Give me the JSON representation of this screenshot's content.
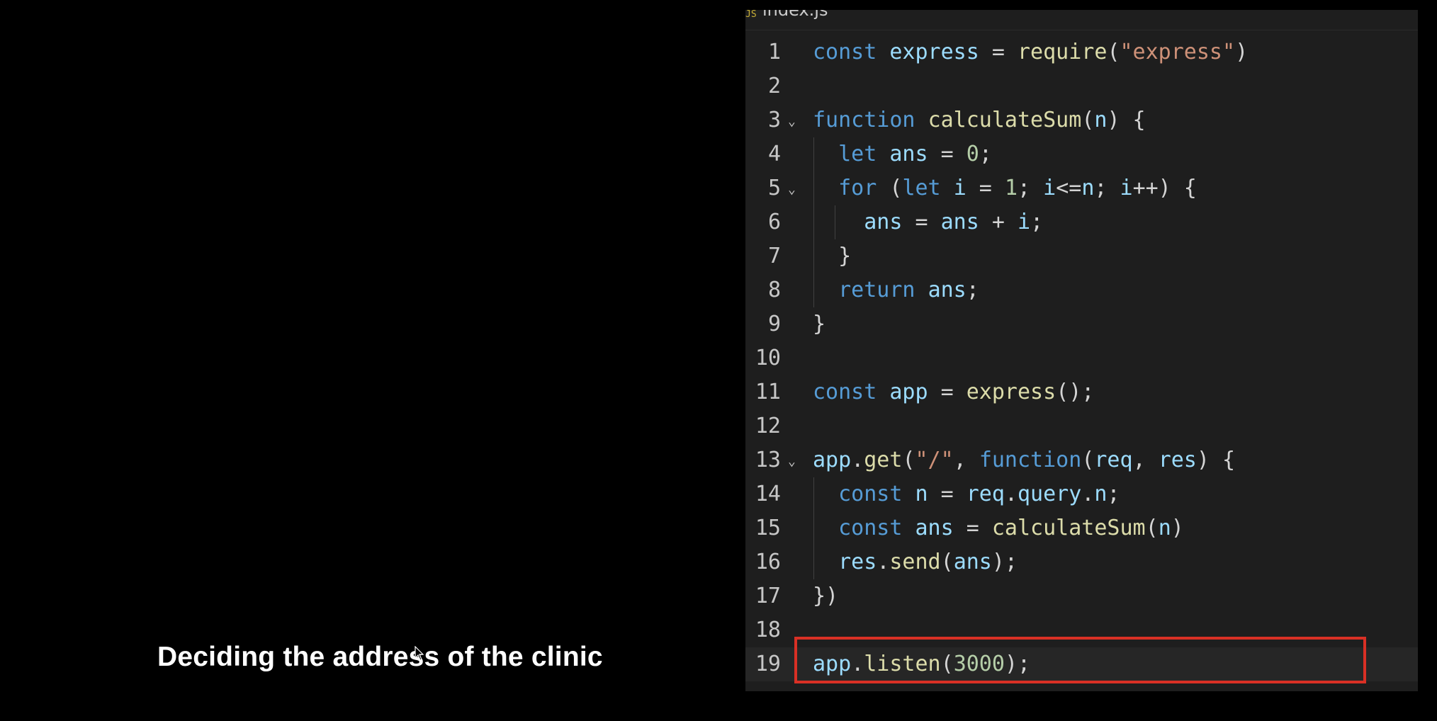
{
  "caption": "Deciding the address of the clinic",
  "editor": {
    "tab_label": "index.js",
    "tab_icon": "JS",
    "current_line": 19,
    "lines": [
      {
        "num": "1",
        "fold": "",
        "tokens": [
          {
            "t": "const",
            "c": "k"
          },
          {
            "t": " ",
            "c": "p"
          },
          {
            "t": "express",
            "c": "v"
          },
          {
            "t": " = ",
            "c": "p"
          },
          {
            "t": "require",
            "c": "f"
          },
          {
            "t": "(",
            "c": "p"
          },
          {
            "t": "\"express\"",
            "c": "s"
          },
          {
            "t": ")",
            "c": "p"
          }
        ]
      },
      {
        "num": "2",
        "fold": "",
        "tokens": []
      },
      {
        "num": "3",
        "fold": "⌄",
        "tokens": [
          {
            "t": "function",
            "c": "k"
          },
          {
            "t": " ",
            "c": "p"
          },
          {
            "t": "calculateSum",
            "c": "f"
          },
          {
            "t": "(",
            "c": "p"
          },
          {
            "t": "n",
            "c": "v"
          },
          {
            "t": ") {",
            "c": "p"
          }
        ]
      },
      {
        "num": "4",
        "fold": "",
        "tokens": [
          {
            "t": "  ",
            "c": "p"
          },
          {
            "t": "let",
            "c": "k"
          },
          {
            "t": " ",
            "c": "p"
          },
          {
            "t": "ans",
            "c": "v"
          },
          {
            "t": " = ",
            "c": "p"
          },
          {
            "t": "0",
            "c": "n"
          },
          {
            "t": ";",
            "c": "p"
          }
        ]
      },
      {
        "num": "5",
        "fold": "⌄",
        "tokens": [
          {
            "t": "  ",
            "c": "p"
          },
          {
            "t": "for",
            "c": "k"
          },
          {
            "t": " (",
            "c": "p"
          },
          {
            "t": "let",
            "c": "k"
          },
          {
            "t": " ",
            "c": "p"
          },
          {
            "t": "i",
            "c": "v"
          },
          {
            "t": " = ",
            "c": "p"
          },
          {
            "t": "1",
            "c": "n"
          },
          {
            "t": "; ",
            "c": "p"
          },
          {
            "t": "i",
            "c": "v"
          },
          {
            "t": "<=",
            "c": "p"
          },
          {
            "t": "n",
            "c": "v"
          },
          {
            "t": "; ",
            "c": "p"
          },
          {
            "t": "i",
            "c": "v"
          },
          {
            "t": "++) {",
            "c": "p"
          }
        ]
      },
      {
        "num": "6",
        "fold": "",
        "tokens": [
          {
            "t": "    ",
            "c": "p"
          },
          {
            "t": "ans",
            "c": "v"
          },
          {
            "t": " = ",
            "c": "p"
          },
          {
            "t": "ans",
            "c": "v"
          },
          {
            "t": " + ",
            "c": "p"
          },
          {
            "t": "i",
            "c": "v"
          },
          {
            "t": ";",
            "c": "p"
          }
        ]
      },
      {
        "num": "7",
        "fold": "",
        "tokens": [
          {
            "t": "  }",
            "c": "p"
          }
        ]
      },
      {
        "num": "8",
        "fold": "",
        "tokens": [
          {
            "t": "  ",
            "c": "p"
          },
          {
            "t": "return",
            "c": "k"
          },
          {
            "t": " ",
            "c": "p"
          },
          {
            "t": "ans",
            "c": "v"
          },
          {
            "t": ";",
            "c": "p"
          }
        ]
      },
      {
        "num": "9",
        "fold": "",
        "tokens": [
          {
            "t": "}",
            "c": "p"
          }
        ]
      },
      {
        "num": "10",
        "fold": "",
        "tokens": []
      },
      {
        "num": "11",
        "fold": "",
        "tokens": [
          {
            "t": "const",
            "c": "k"
          },
          {
            "t": " ",
            "c": "p"
          },
          {
            "t": "app",
            "c": "v"
          },
          {
            "t": " = ",
            "c": "p"
          },
          {
            "t": "express",
            "c": "f"
          },
          {
            "t": "();",
            "c": "p"
          }
        ]
      },
      {
        "num": "12",
        "fold": "",
        "tokens": []
      },
      {
        "num": "13",
        "fold": "⌄",
        "tokens": [
          {
            "t": "app",
            "c": "v"
          },
          {
            "t": ".",
            "c": "p"
          },
          {
            "t": "get",
            "c": "f"
          },
          {
            "t": "(",
            "c": "p"
          },
          {
            "t": "\"/\"",
            "c": "s"
          },
          {
            "t": ", ",
            "c": "p"
          },
          {
            "t": "function",
            "c": "k"
          },
          {
            "t": "(",
            "c": "p"
          },
          {
            "t": "req",
            "c": "v"
          },
          {
            "t": ", ",
            "c": "p"
          },
          {
            "t": "res",
            "c": "v"
          },
          {
            "t": ") {",
            "c": "p"
          }
        ]
      },
      {
        "num": "14",
        "fold": "",
        "tokens": [
          {
            "t": "  ",
            "c": "p"
          },
          {
            "t": "const",
            "c": "k"
          },
          {
            "t": " ",
            "c": "p"
          },
          {
            "t": "n",
            "c": "v"
          },
          {
            "t": " = ",
            "c": "p"
          },
          {
            "t": "req",
            "c": "v"
          },
          {
            "t": ".",
            "c": "p"
          },
          {
            "t": "query",
            "c": "v"
          },
          {
            "t": ".",
            "c": "p"
          },
          {
            "t": "n",
            "c": "v"
          },
          {
            "t": ";",
            "c": "p"
          }
        ]
      },
      {
        "num": "15",
        "fold": "",
        "tokens": [
          {
            "t": "  ",
            "c": "p"
          },
          {
            "t": "const",
            "c": "k"
          },
          {
            "t": " ",
            "c": "p"
          },
          {
            "t": "ans",
            "c": "v"
          },
          {
            "t": " = ",
            "c": "p"
          },
          {
            "t": "calculateSum",
            "c": "f"
          },
          {
            "t": "(",
            "c": "p"
          },
          {
            "t": "n",
            "c": "v"
          },
          {
            "t": ")",
            "c": "p"
          }
        ]
      },
      {
        "num": "16",
        "fold": "",
        "tokens": [
          {
            "t": "  ",
            "c": "p"
          },
          {
            "t": "res",
            "c": "v"
          },
          {
            "t": ".",
            "c": "p"
          },
          {
            "t": "send",
            "c": "f"
          },
          {
            "t": "(",
            "c": "p"
          },
          {
            "t": "ans",
            "c": "v"
          },
          {
            "t": ");",
            "c": "p"
          }
        ]
      },
      {
        "num": "17",
        "fold": "",
        "tokens": [
          {
            "t": "})",
            "c": "p"
          }
        ]
      },
      {
        "num": "18",
        "fold": "",
        "tokens": []
      },
      {
        "num": "19",
        "fold": "",
        "tokens": [
          {
            "t": "app",
            "c": "v"
          },
          {
            "t": ".",
            "c": "p"
          },
          {
            "t": "listen",
            "c": "f"
          },
          {
            "t": "(",
            "c": "p"
          },
          {
            "t": "3000",
            "c": "n"
          },
          {
            "t": ");",
            "c": "p"
          }
        ]
      }
    ]
  },
  "colors": {
    "highlight_box": "#d93025",
    "keyword": "#569cd6",
    "function": "#dcdcaa",
    "variable": "#9cdcfe",
    "string": "#ce9178",
    "number": "#b5cea8",
    "background": "#1e1e1e"
  }
}
